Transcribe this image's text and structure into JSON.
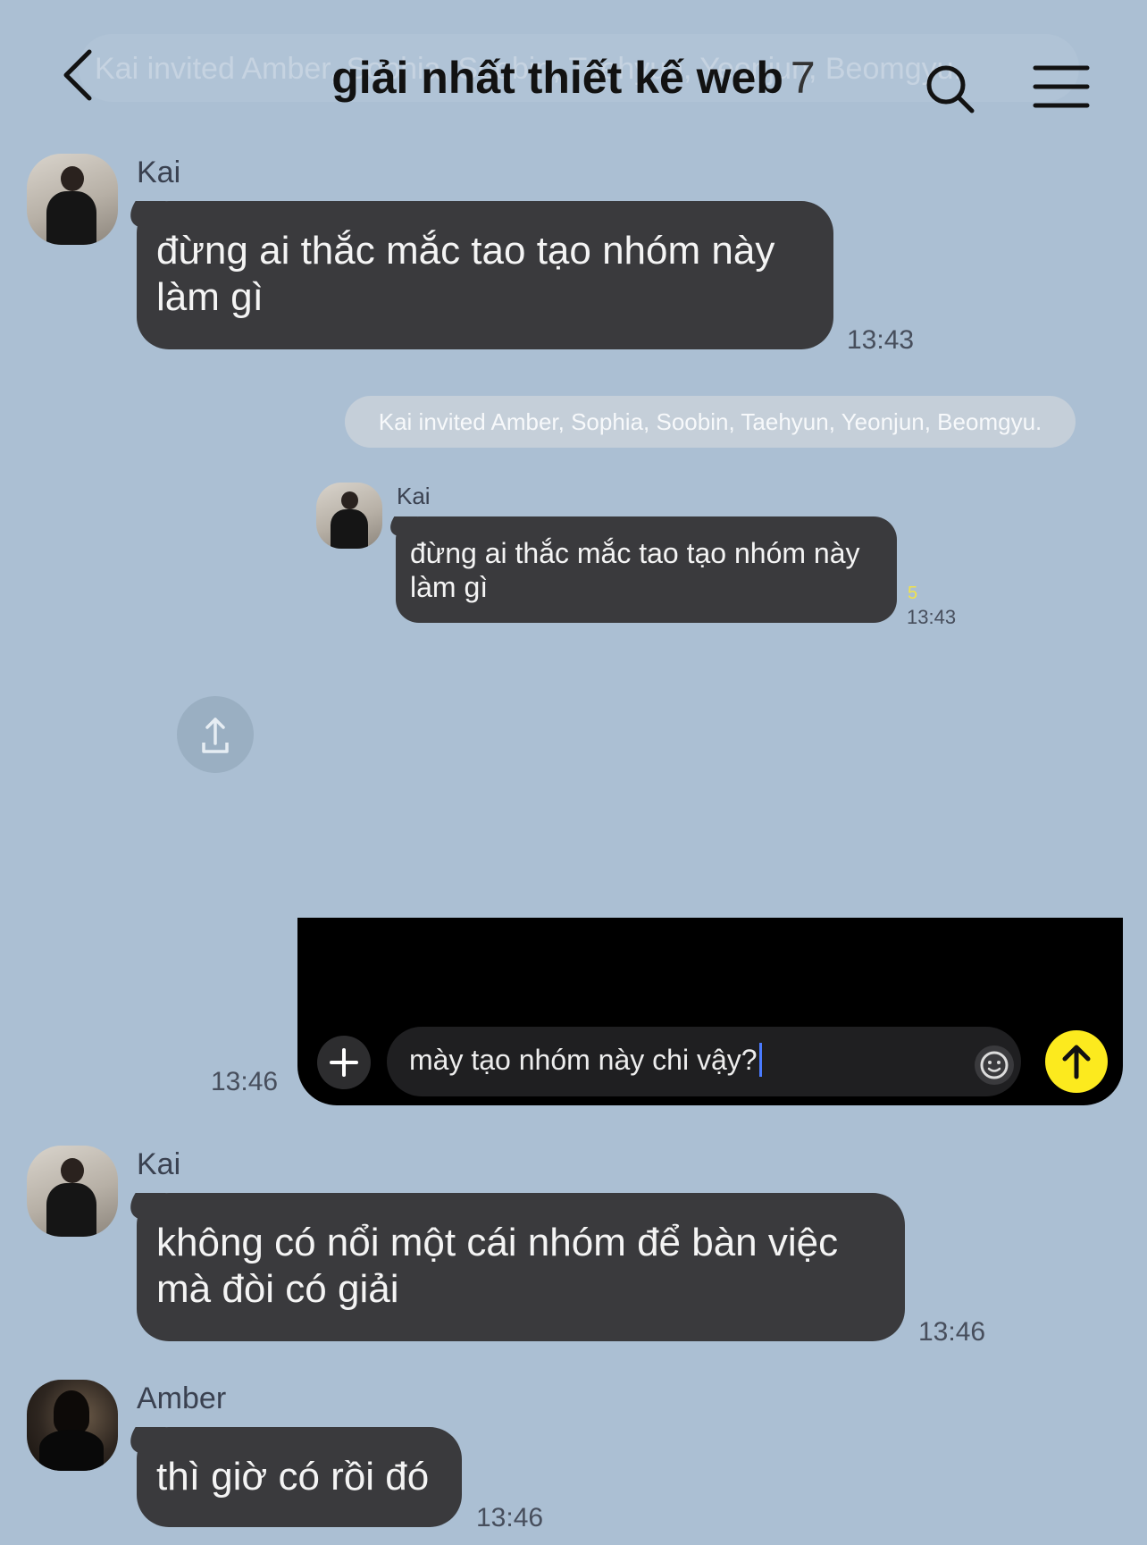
{
  "header": {
    "title": "giải nhất thiết kế web",
    "member_count": "7",
    "ghost_text": "Kai invited Amber, Sophia, Soobin, Taehyun, Yeonjun, Beomgyu."
  },
  "messages": [
    {
      "sender": "Kai",
      "text_line1": "đừng ai thắc mắc tao tạo nhóm này",
      "text_line2": "làm gì",
      "time": "13:43"
    },
    {
      "sender": "Kai",
      "text_line1": "không có nổi một cái nhóm để bàn việc",
      "text_line2": "mà đòi có giải",
      "time": "13:46"
    },
    {
      "sender": "Amber",
      "text_line1": "thì giờ có rồi đó",
      "time": "13:46"
    }
  ],
  "screenshot": {
    "system_notice": "Kai invited Amber, Sophia, Soobin, Taehyun, Yeonjun, Beomgyu.",
    "sender": "Kai",
    "text_line1": "đừng ai thắc mắc tao tạo nhóm này",
    "text_line2": "làm gì",
    "unread_count": "5",
    "time": "13:43"
  },
  "composer_image": {
    "input_text": "mày tạo nhóm này chi vậy?",
    "time": "13:46"
  },
  "colors": {
    "background": "#abbfd3",
    "bubble": "#3a3a3d",
    "send_button": "#fcea1e"
  },
  "icons": [
    "back-chevron-icon",
    "search-icon",
    "menu-icon",
    "share-icon",
    "plus-icon",
    "emoji-icon",
    "send-arrow-icon"
  ]
}
